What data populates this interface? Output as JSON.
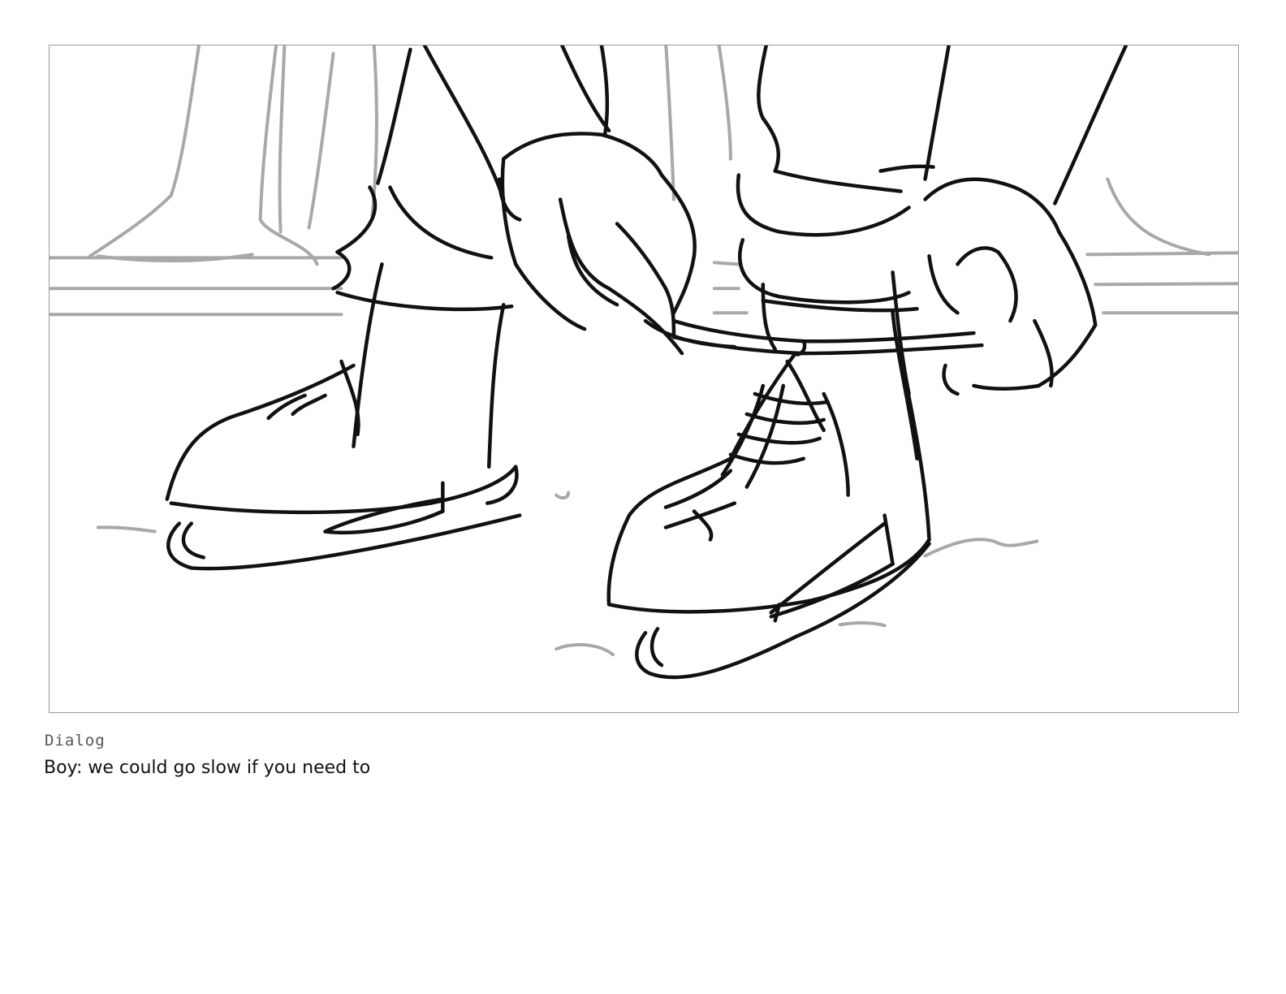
{
  "panel": {
    "image": "storyboard-sketch-tying-ice-skate-laces"
  },
  "dialog": {
    "label": "Dialog",
    "text": "Boy: we could go slow if you need to"
  }
}
